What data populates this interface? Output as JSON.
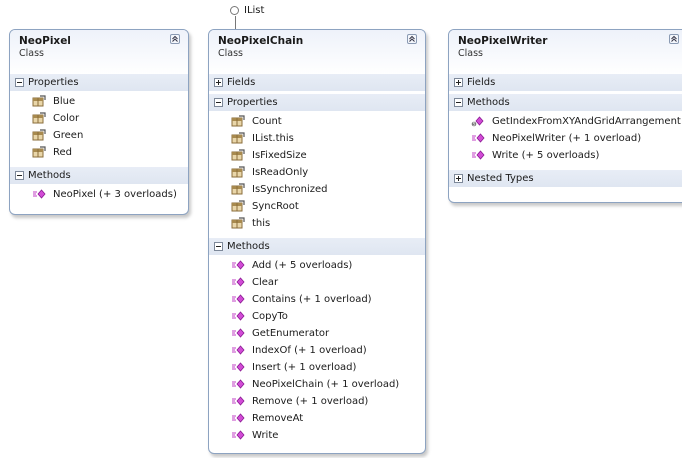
{
  "interface": {
    "label": "IList"
  },
  "classes": [
    {
      "name": "NeoPixel",
      "kind": "Class",
      "sections": [
        {
          "label": "Properties",
          "expanded": true,
          "members": [
            {
              "label": "Blue",
              "icon": "property-icon"
            },
            {
              "label": "Color",
              "icon": "property-icon"
            },
            {
              "label": "Green",
              "icon": "property-icon"
            },
            {
              "label": "Red",
              "icon": "property-icon"
            }
          ]
        },
        {
          "label": "Methods",
          "expanded": true,
          "members": [
            {
              "label": "NeoPixel (+ 3 overloads)",
              "icon": "method-icon"
            }
          ]
        }
      ]
    },
    {
      "name": "NeoPixelChain",
      "kind": "Class",
      "sections": [
        {
          "label": "Fields",
          "expanded": false,
          "members": []
        },
        {
          "label": "Properties",
          "expanded": true,
          "members": [
            {
              "label": "Count",
              "icon": "property-icon"
            },
            {
              "label": "IList.this",
              "icon": "property-icon"
            },
            {
              "label": "IsFixedSize",
              "icon": "property-icon"
            },
            {
              "label": "IsReadOnly",
              "icon": "property-icon"
            },
            {
              "label": "IsSynchronized",
              "icon": "property-icon"
            },
            {
              "label": "SyncRoot",
              "icon": "property-icon"
            },
            {
              "label": "this",
              "icon": "property-icon"
            }
          ]
        },
        {
          "label": "Methods",
          "expanded": true,
          "members": [
            {
              "label": "Add (+ 5 overloads)",
              "icon": "method-icon"
            },
            {
              "label": "Clear",
              "icon": "method-icon"
            },
            {
              "label": "Contains (+ 1 overload)",
              "icon": "method-icon"
            },
            {
              "label": "CopyTo",
              "icon": "method-icon"
            },
            {
              "label": "GetEnumerator",
              "icon": "method-icon"
            },
            {
              "label": "IndexOf (+ 1 overload)",
              "icon": "method-icon"
            },
            {
              "label": "Insert (+ 1 overload)",
              "icon": "method-icon"
            },
            {
              "label": "NeoPixelChain (+ 1 overload)",
              "icon": "method-icon"
            },
            {
              "label": "Remove (+ 1 overload)",
              "icon": "method-icon"
            },
            {
              "label": "RemoveAt",
              "icon": "method-icon"
            },
            {
              "label": "Write",
              "icon": "method-icon"
            }
          ]
        }
      ]
    },
    {
      "name": "NeoPixelWriter",
      "kind": "Class",
      "sections": [
        {
          "label": "Fields",
          "expanded": false,
          "members": []
        },
        {
          "label": "Methods",
          "expanded": true,
          "members": [
            {
              "label": "GetIndexFromXYAndGridArrangement",
              "icon": "static-method-icon"
            },
            {
              "label": "NeoPixelWriter (+ 1 overload)",
              "icon": "method-icon"
            },
            {
              "label": "Write (+ 5 overloads)",
              "icon": "method-icon"
            }
          ]
        },
        {
          "label": "Nested Types",
          "expanded": false,
          "members": []
        }
      ]
    }
  ],
  "colors": {
    "border": "#8da3c1",
    "section_bg": "#e3e9f3",
    "method_icon": "#c13fc6",
    "property_icon": "#8a6d3b"
  }
}
